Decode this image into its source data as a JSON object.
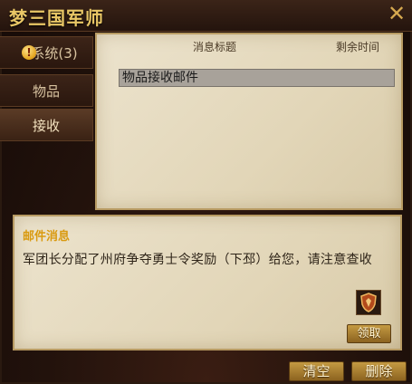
{
  "window": {
    "title": "梦三国军师",
    "close_icon": "close-icon"
  },
  "tabs": [
    {
      "label": "系统(3)",
      "badge": "!"
    },
    {
      "label": "物品"
    },
    {
      "label": "接收"
    }
  ],
  "mail_list": {
    "columns": [
      "消息标题",
      "剩余时间"
    ],
    "rows": [
      {
        "title": "物品接收邮件",
        "time": ""
      }
    ]
  },
  "message": {
    "heading": "邮件消息",
    "body": "军团长分配了州府争夺勇士令奖励（下邳）给您，请注意查收",
    "reward_icon": "shield-badge-icon",
    "claim_label": "领取"
  },
  "footer": {
    "clear_label": "清空",
    "delete_label": "删除"
  },
  "colors": {
    "accent": "#e9c766",
    "heading": "#d99a10",
    "button": "#b08535"
  }
}
